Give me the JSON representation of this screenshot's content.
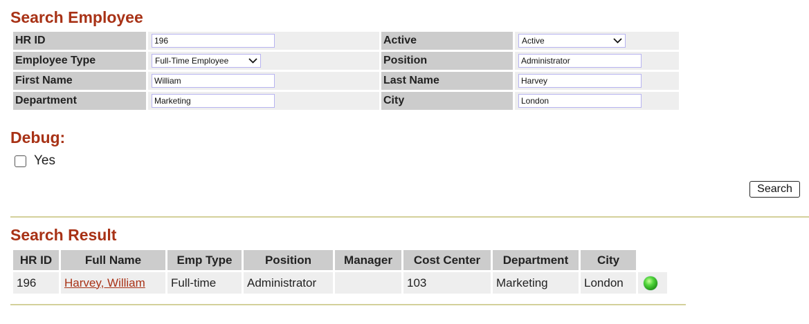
{
  "search": {
    "title": "Search Employee",
    "fields": {
      "hr_id": {
        "label": "HR ID",
        "value": "196"
      },
      "active": {
        "label": "Active",
        "value": "Active"
      },
      "employee_type": {
        "label": "Employee Type",
        "value": "Full-Time Employee"
      },
      "position": {
        "label": "Position",
        "value": "Administrator"
      },
      "first_name": {
        "label": "First Name",
        "value": "William"
      },
      "last_name": {
        "label": "Last Name",
        "value": "Harvey"
      },
      "department": {
        "label": "Department",
        "value": "Marketing"
      },
      "city": {
        "label": "City",
        "value": "London"
      }
    },
    "button_label": "Search"
  },
  "debug": {
    "title": "Debug:",
    "checkbox_label": "Yes",
    "checked": false
  },
  "results": {
    "title": "Search Result",
    "columns": [
      "HR ID",
      "Full Name",
      "Emp Type",
      "Position",
      "Manager",
      "Cost Center",
      "Department",
      "City"
    ],
    "rows": [
      {
        "hr_id": "196",
        "full_name": "Harvey, William",
        "emp_type": "Full-time",
        "position": "Administrator",
        "manager": "",
        "cost_center": "103",
        "department": "Marketing",
        "city": "London",
        "status_icon": "green-status-icon"
      }
    ]
  },
  "colors": {
    "heading": "#a83216",
    "label_bg": "#cccccc",
    "value_bg": "#eeeeee",
    "rule": "#d3d09a",
    "status": "#2fbf1e"
  }
}
